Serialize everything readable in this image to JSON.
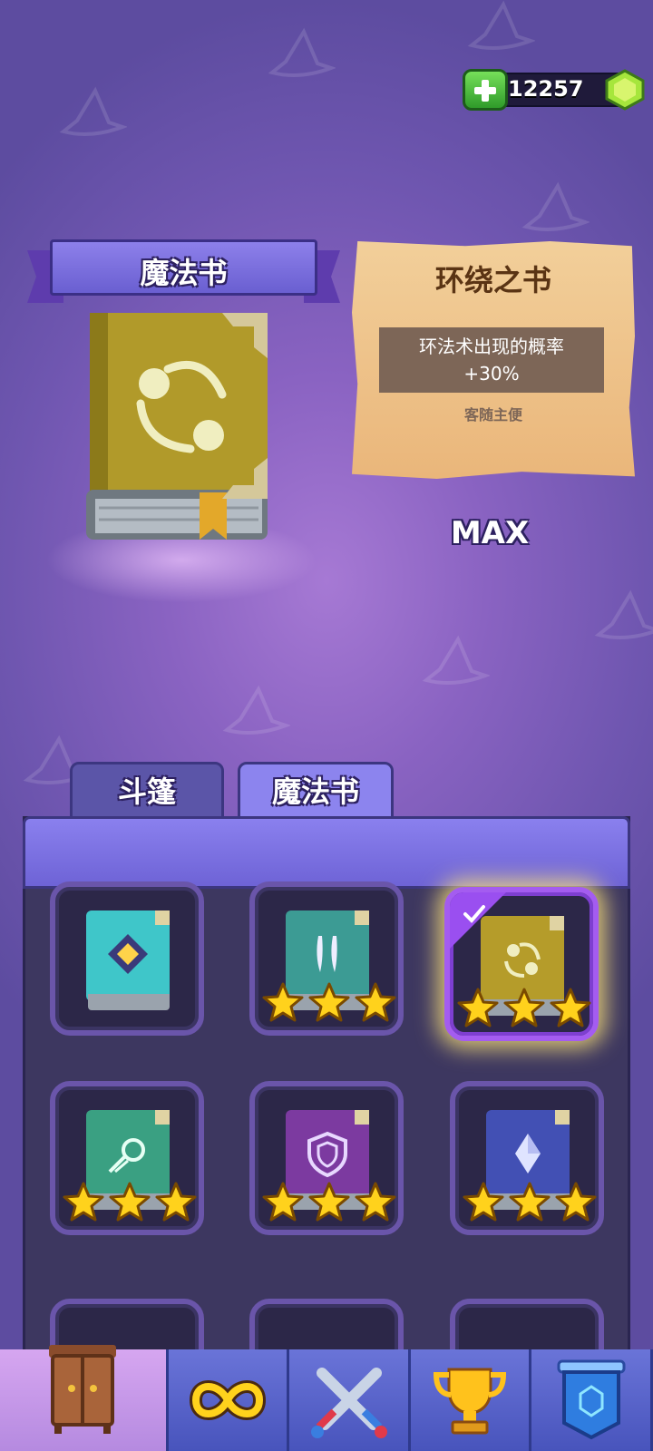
{
  "currency": {
    "amount": "12257",
    "icons": [
      "plus-icon",
      "gem-icon"
    ]
  },
  "header": {
    "ribbon_title": "魔法书"
  },
  "selected_book": {
    "name": "环绕之书",
    "description_line1": "环法术出现的概率",
    "description_line2": "+30%",
    "author": "客随主便",
    "level": "MAX"
  },
  "tabs": [
    {
      "label": "斗篷",
      "active": false
    },
    {
      "label": "魔法书",
      "active": true
    }
  ],
  "books": [
    {
      "name": "diamond-book",
      "color": "#3fc6c9",
      "stars": 0,
      "selected": false
    },
    {
      "name": "claws-book",
      "color": "#3c9b94",
      "stars": 3,
      "selected": false
    },
    {
      "name": "orbit-book",
      "color": "#b59c2a",
      "stars": 3,
      "selected": true
    },
    {
      "name": "comet-book",
      "color": "#3aa082",
      "stars": 3,
      "selected": false
    },
    {
      "name": "shield-book",
      "color": "#7c3aa0",
      "stars": 3,
      "selected": false
    },
    {
      "name": "crystal-book",
      "color": "#4250b4",
      "stars": 3,
      "selected": false
    }
  ],
  "nav": [
    "wardrobe-icon",
    "infinity-icon",
    "crossed-swords-icon",
    "trophy-icon",
    "banner-icon"
  ],
  "colors": {
    "accent": "#8c84ee",
    "gold_star": "#ffd21c",
    "parchment": "#f2cf9a"
  }
}
